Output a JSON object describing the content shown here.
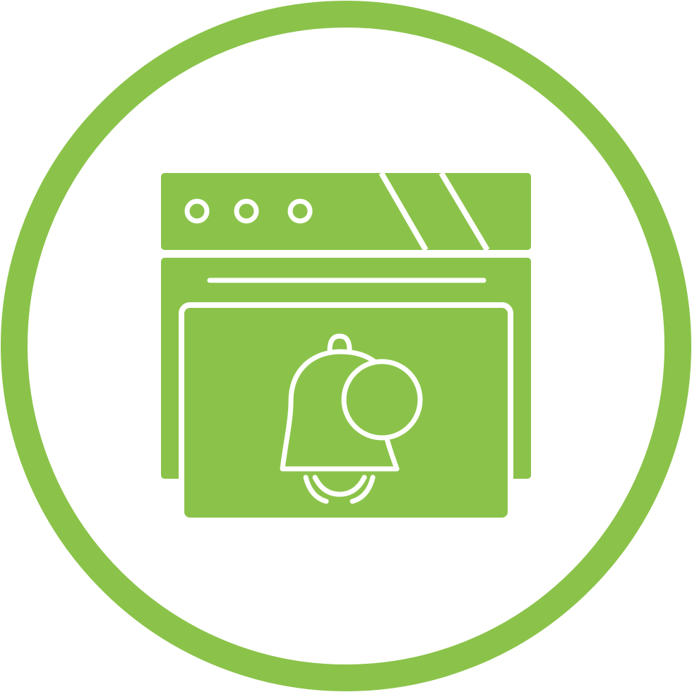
{
  "icon": {
    "name": "web-notification-icon",
    "theme": {
      "accent": "#8bc34a",
      "background": "#ffffff",
      "line": "#ffffff"
    },
    "browser": {
      "window_controls": 3,
      "tabs": 2
    },
    "bell": {
      "has_badge": true,
      "ringing": true
    }
  }
}
